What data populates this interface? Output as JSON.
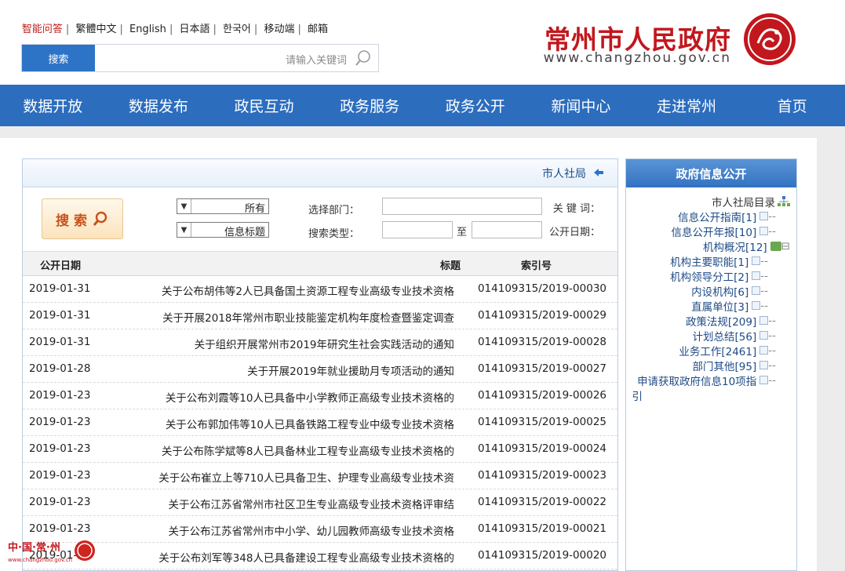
{
  "header": {
    "lang_links": [
      "智能问答",
      "繁體中文",
      "English",
      "日本語",
      "한국어",
      "移动端",
      "邮箱"
    ],
    "search_placeholder": "请输入关键词",
    "search_button": "搜索",
    "site_title": "常州市人民政府",
    "site_url": "www.changzhou.gov.cn"
  },
  "nav": [
    "首页",
    "走进常州",
    "新闻中心",
    "政务公开",
    "政务服务",
    "政民互动",
    "数据发布",
    "数据开放"
  ],
  "main": {
    "panel_title": "市人社局",
    "filters": {
      "keyword_label": "关 键 词：",
      "dept_label": "选择部门：",
      "dept_value": "所有",
      "date_label": "公开日期：",
      "date_to": "至",
      "type_label": "搜索类型：",
      "type_value": "信息标题",
      "search_button": "搜 索"
    },
    "columns": {
      "index": "索引号",
      "title": "标题",
      "date": "公开日期"
    },
    "rows": [
      {
        "index": "014109315/2019-00030",
        "title": "关于公布胡伟等2人已具备国土资源工程专业高级专业技术资格",
        "date": "2019-01-31"
      },
      {
        "index": "014109315/2019-00029",
        "title": "关于开展2018年常州市职业技能鉴定机构年度检查暨鉴定调查",
        "date": "2019-01-31"
      },
      {
        "index": "014109315/2019-00028",
        "title": "关于组织开展常州市2019年研究生社会实践活动的通知",
        "date": "2019-01-31"
      },
      {
        "index": "014109315/2019-00027",
        "title": "关于开展2019年就业援助月专项活动的通知",
        "date": "2019-01-28"
      },
      {
        "index": "014109315/2019-00026",
        "title": "关于公布刘霞等10人已具备中小学教师正高级专业技术资格的",
        "date": "2019-01-23"
      },
      {
        "index": "014109315/2019-00025",
        "title": "关于公布郭加伟等10人已具备铁路工程专业中级专业技术资格",
        "date": "2019-01-23"
      },
      {
        "index": "014109315/2019-00024",
        "title": "关于公布陈学斌等8人已具备林业工程专业高级专业技术资格的",
        "date": "2019-01-23"
      },
      {
        "index": "014109315/2019-00023",
        "title": "关于公布崔立上等710人已具备卫生、护理专业高级专业技术资",
        "date": "2019-01-23"
      },
      {
        "index": "014109315/2019-00022",
        "title": "关于公布江苏省常州市社区卫生专业高级专业技术资格评审结",
        "date": "2019-01-23"
      },
      {
        "index": "014109315/2019-00021",
        "title": "关于公布江苏省常州市中小学、幼儿园教师高级专业技术资格",
        "date": "2019-01-23"
      },
      {
        "index": "014109315/2019-00020",
        "title": "关于公布刘军等348人已具备建设工程专业高级专业技术资格的",
        "date": "2019-01-23"
      }
    ]
  },
  "sidebar": {
    "title": "政府信息公开",
    "root": "市人社局目录",
    "items": [
      {
        "label": "信息公开指南[1]"
      },
      {
        "label": "信息公开年报[10]"
      },
      {
        "label": "机构概况[12]"
      },
      {
        "label": "机构主要职能[1]"
      },
      {
        "label": "机构领导分工[2]"
      },
      {
        "label": "内设机构[6]"
      },
      {
        "label": "直属单位[3]"
      },
      {
        "label": "政策法规[209]"
      },
      {
        "label": "计划总结[56]"
      },
      {
        "label": "业务工作[2461]"
      },
      {
        "label": "部门其他[95]"
      },
      {
        "label": "申请获取政府信息10项指"
      },
      {
        "label": "引"
      }
    ]
  },
  "colors": {
    "nav_bg": "#2c6dbe",
    "title_red": "#c2171d",
    "side_head": "#3272c0"
  }
}
